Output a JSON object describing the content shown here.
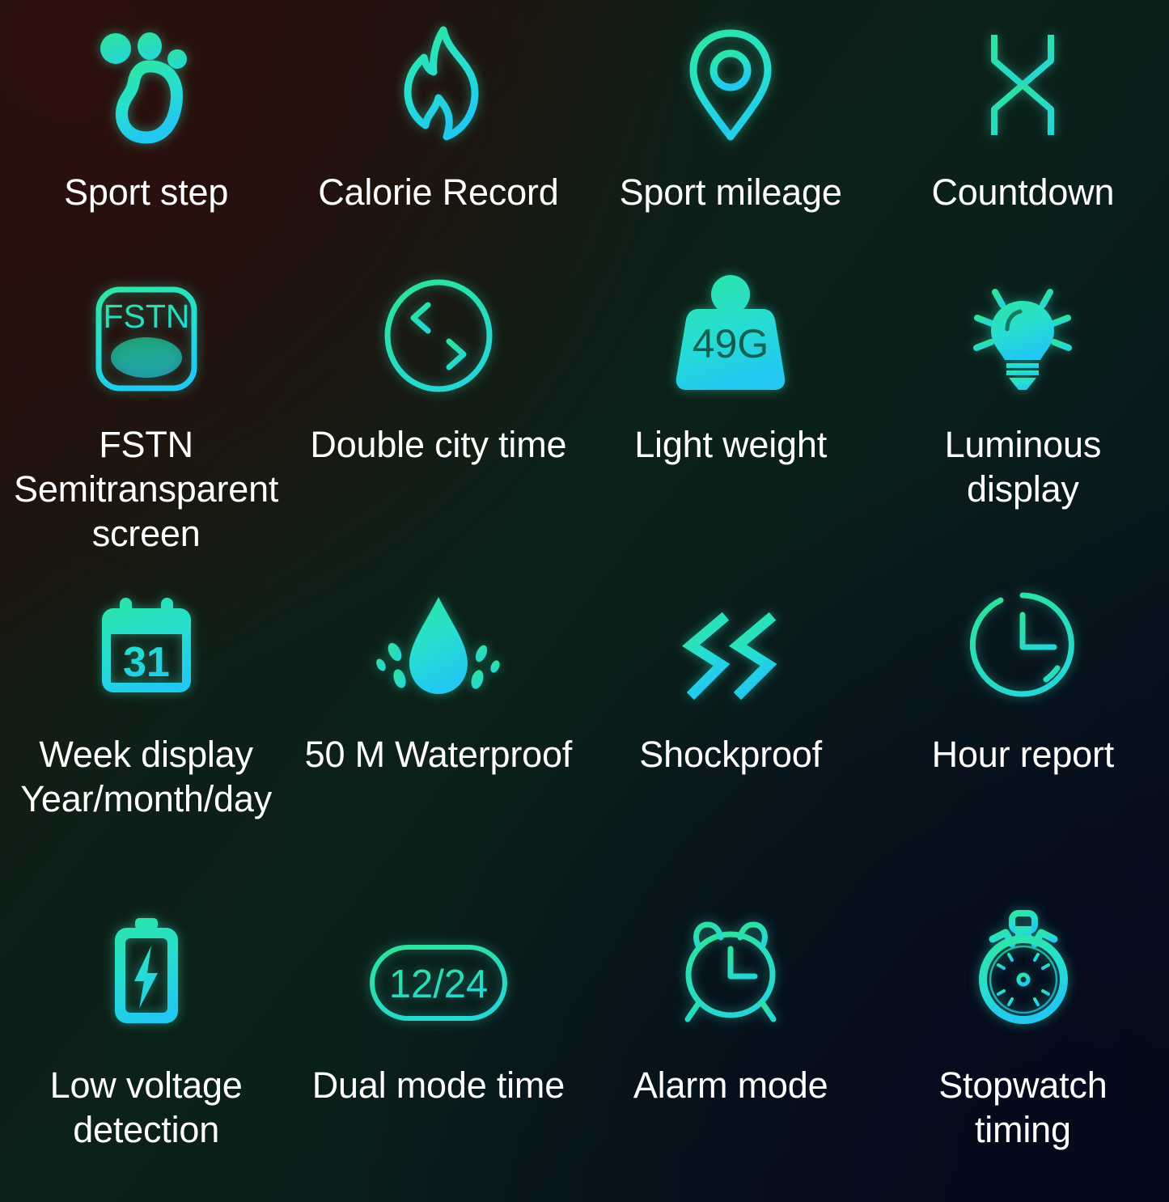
{
  "page": {
    "title": "Smart Watch Feature Grid",
    "background_colors": {
      "top_left": "#251008",
      "mid": "#0b2119",
      "bottom_right": "#060c1c"
    },
    "label_color": "#ffffff",
    "icon_gradient_start": "#2de6a0",
    "icon_gradient_end": "#22d3ee"
  },
  "features": [
    {
      "id": "sport-step",
      "icon": "footprint-icon",
      "label": "Sport step"
    },
    {
      "id": "calorie-record",
      "icon": "flame-icon",
      "label": "Calorie Record"
    },
    {
      "id": "sport-mileage",
      "icon": "map-pin-icon",
      "label": "Sport mileage"
    },
    {
      "id": "countdown",
      "icon": "hourglass-icon",
      "label": "Countdown"
    },
    {
      "id": "fstn-screen",
      "icon": "fstn-screen-icon",
      "label": "FSTN Semitransparent screen",
      "icon_text": "FSTN"
    },
    {
      "id": "double-city-time",
      "icon": "two-way-arrows-icon",
      "label": "Double city time"
    },
    {
      "id": "light-weight",
      "icon": "weight-icon",
      "label": "Light weight",
      "icon_text": "49G"
    },
    {
      "id": "luminous-display",
      "icon": "lightbulb-icon",
      "label": "Luminous display"
    },
    {
      "id": "week-display",
      "icon": "calendar-icon",
      "label": "Week display Year/month/day",
      "icon_text": "31"
    },
    {
      "id": "waterproof",
      "icon": "water-drop-icon",
      "label": "50 M Waterproof"
    },
    {
      "id": "shockproof",
      "icon": "double-chevron-icon",
      "label": "Shockproof"
    },
    {
      "id": "hour-report",
      "icon": "clock-icon",
      "label": "Hour report"
    },
    {
      "id": "low-voltage",
      "icon": "battery-bolt-icon",
      "label": "Low voltage detection"
    },
    {
      "id": "dual-mode-time",
      "icon": "twelve-24-icon",
      "label": "Dual mode time",
      "icon_text": "12/24"
    },
    {
      "id": "alarm-mode",
      "icon": "alarm-clock-icon",
      "label": "Alarm mode"
    },
    {
      "id": "stopwatch-timing",
      "icon": "stopwatch-icon",
      "label": "Stopwatch timing"
    }
  ]
}
